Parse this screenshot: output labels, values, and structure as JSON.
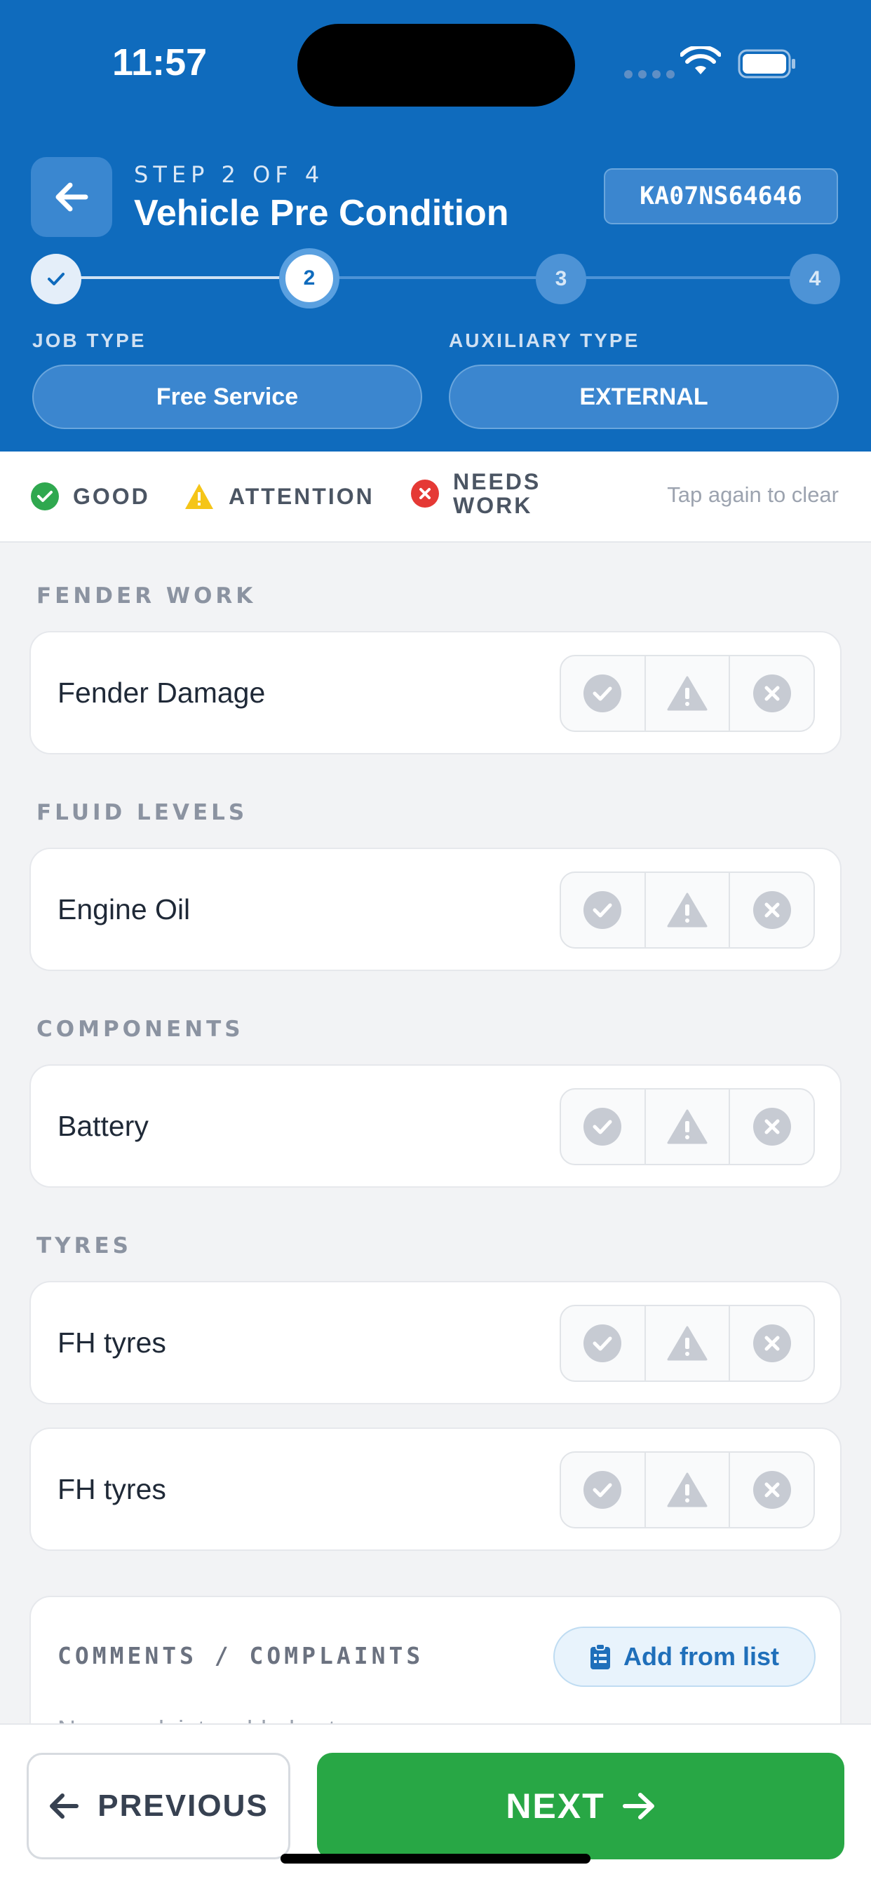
{
  "status_bar": {
    "time": "11:57"
  },
  "header": {
    "step_label": "STEP 2 OF 4",
    "title": "Vehicle Pre Condition",
    "plate": "KA07NS64646",
    "stepper": [
      {
        "label": "",
        "state": "done"
      },
      {
        "label": "2",
        "state": "current"
      },
      {
        "label": "3",
        "state": "upcoming"
      },
      {
        "label": "4",
        "state": "upcoming"
      }
    ],
    "job_type_label": "JOB TYPE",
    "job_type_value": "Free Service",
    "aux_type_label": "AUXILIARY TYPE",
    "aux_type_value": "EXTERNAL"
  },
  "legend": {
    "good": "GOOD",
    "attention": "ATTENTION",
    "needs_work_1": "NEEDS",
    "needs_work_2": "WORK",
    "hint": "Tap again to clear"
  },
  "sections": [
    {
      "title": "FENDER WORK",
      "items": [
        "Fender Damage"
      ]
    },
    {
      "title": "FLUID LEVELS",
      "items": [
        "Engine Oil"
      ]
    },
    {
      "title": "COMPONENTS",
      "items": [
        "Battery"
      ]
    },
    {
      "title": "TYRES",
      "items": [
        "FH tyres",
        "FH tyres"
      ]
    }
  ],
  "comments": {
    "title": "COMMENTS / COMPLAINTS",
    "add_label": "Add from list",
    "empty": "No complaints added yet"
  },
  "footer": {
    "previous": "PREVIOUS",
    "next": "NEXT"
  },
  "colors": {
    "header_bg": "#0f6bbd",
    "good": "#2fa84f",
    "attention": "#f5c518",
    "needs_work": "#e53935",
    "next_bg": "#28a745"
  }
}
